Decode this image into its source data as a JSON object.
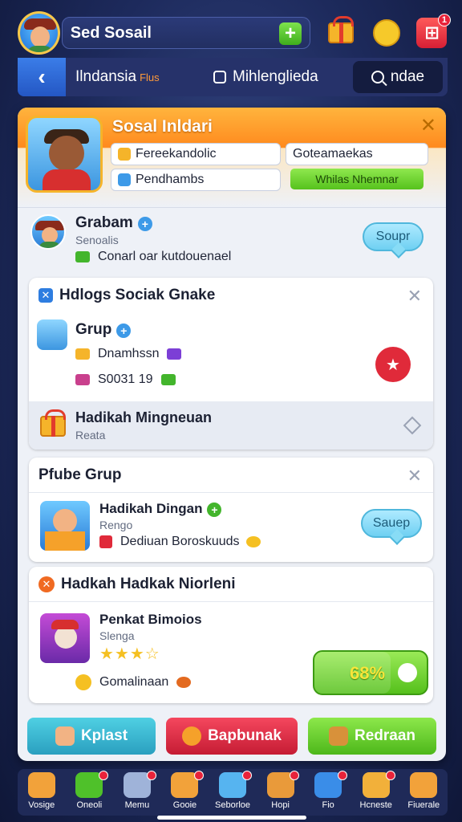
{
  "topbar": {
    "title": "Sed Sosail",
    "notification_count": "1"
  },
  "tabs": {
    "tab1_label": "Ilndansia",
    "tab1_tag": "Flus",
    "tab2_label": "Mihlenglieda",
    "search_label": "ndae"
  },
  "panel": {
    "title": "Sosal Inldari",
    "chip1": "Fereekandolic",
    "chip2": "Pendhambs",
    "chip3": "Goteamaekas",
    "green_button": "Whilas Nhemnar"
  },
  "row_a": {
    "name": "Grabam",
    "sub": "Senoalis",
    "line": "Conarl oar kutdouenael",
    "bubble": "Soupr"
  },
  "card1": {
    "title": "Hdlogs Sociak Gnake",
    "group_name": "Grup",
    "line1": "Dnamhssn",
    "line2": "S0031 19",
    "gift_title": "Hadikah Mingneuan",
    "gift_sub": "Reata"
  },
  "card2": {
    "title": "Pfube Grup",
    "item_name": "Hadikah Dingan",
    "item_sub": "Rengo",
    "item_line": "Dediuan Boroskuuds",
    "bubble": "Sauep"
  },
  "card3": {
    "title": "Hadkah Hadkak Niorleni",
    "item_name": "Penkat Bimoios",
    "item_sub": "Slenga",
    "rating": 3.5,
    "stars": "★★★☆",
    "coin_line": "Gomalinaan",
    "progress_label": "68%",
    "progress": 0.68
  },
  "actions": {
    "left": "Kplast",
    "center": "Bapbunak",
    "right": "Redraan"
  },
  "nav": [
    {
      "label": "Vosige",
      "icon": "chest-icon",
      "color": "#f2a23a"
    },
    {
      "label": "Oneoli",
      "icon": "globe-icon",
      "color": "#4fc12a"
    },
    {
      "label": "Memu",
      "icon": "house-icon",
      "color": "#9fb3d9"
    },
    {
      "label": "Gooie",
      "icon": "box-icon",
      "color": "#f2a23a"
    },
    {
      "label": "Seborloe",
      "icon": "mail-icon",
      "color": "#56b4f0"
    },
    {
      "label": "Hopi",
      "icon": "pet-icon",
      "color": "#e99a3a"
    },
    {
      "label": "Fio",
      "icon": "chat-icon",
      "color": "#3a8de8"
    },
    {
      "label": "Hcneste",
      "icon": "cookie-icon",
      "color": "#f2b03a"
    },
    {
      "label": "Fiuerale",
      "icon": "trophy-icon",
      "color": "#f2a23a"
    }
  ],
  "colors": {
    "accent": "#2457c4",
    "panel_head": "#ff8a1e",
    "green": "#56c21d",
    "red": "#d61f35"
  }
}
